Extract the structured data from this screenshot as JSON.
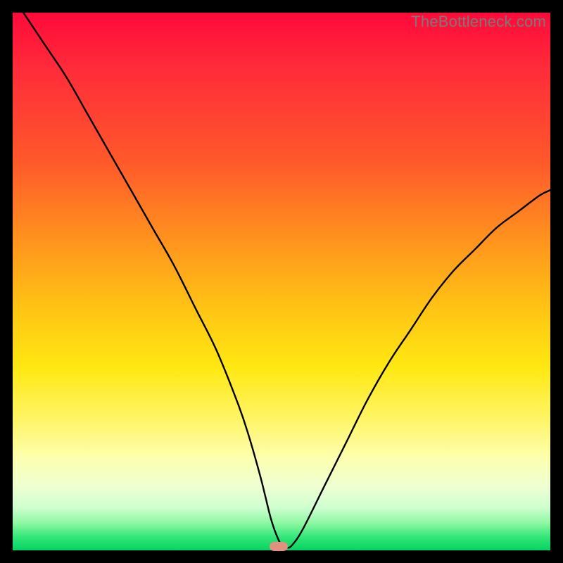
{
  "watermark": "TheBottleneck.com",
  "marker": {
    "x_frac": 0.495,
    "y_frac": 0.993
  },
  "chart_data": {
    "type": "line",
    "title": "",
    "xlabel": "",
    "ylabel": "",
    "xlim": [
      0,
      100
    ],
    "ylim": [
      0,
      100
    ],
    "series": [
      {
        "name": "bottleneck-curve",
        "x": [
          2,
          6,
          10,
          14,
          18,
          22,
          26,
          30,
          34,
          38,
          42,
          44,
          46,
          47,
          48,
          49,
          50,
          51,
          52,
          54,
          58,
          62,
          66,
          70,
          74,
          78,
          82,
          86,
          90,
          94,
          98,
          100
        ],
        "y": [
          100,
          94,
          88,
          81,
          74,
          67,
          60,
          53,
          45,
          37,
          27,
          21,
          14,
          10,
          6,
          3,
          1,
          0.5,
          1,
          4,
          12,
          20,
          28,
          35,
          41,
          47,
          52,
          56,
          60,
          63,
          66,
          67
        ]
      }
    ],
    "gradient_stops": [
      {
        "pos": 0.0,
        "color": "#ff0a3a"
      },
      {
        "pos": 0.5,
        "color": "#ffc414"
      },
      {
        "pos": 0.8,
        "color": "#fff56a"
      },
      {
        "pos": 0.97,
        "color": "#33e77a"
      },
      {
        "pos": 1.0,
        "color": "#05d35f"
      }
    ]
  }
}
